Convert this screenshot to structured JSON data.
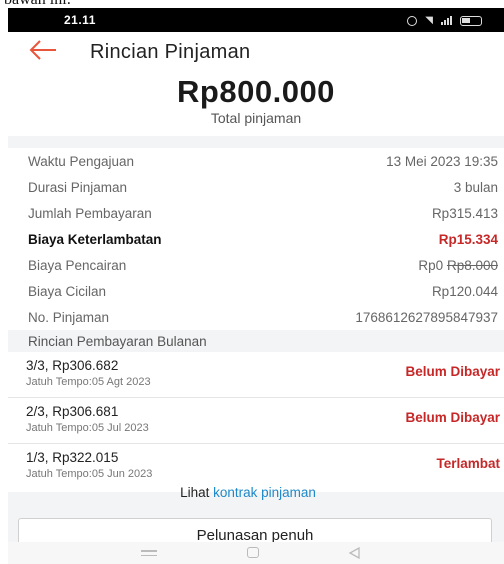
{
  "cut_text": "bawah ini:",
  "status": {
    "time": "21.11"
  },
  "header": {
    "title": "Rincian Pinjaman"
  },
  "summary": {
    "amount": "Rp800.000",
    "label": "Total pinjaman"
  },
  "details": [
    {
      "label": "Waktu Pengajuan",
      "value": "13 Mei 2023 19:35"
    },
    {
      "label": "Durasi Pinjaman",
      "value": "3 bulan"
    },
    {
      "label": "Jumlah Pembayaran",
      "value": "Rp315.413"
    },
    {
      "label": "Biaya Keterlambatan",
      "value": "Rp15.334"
    },
    {
      "label": "Biaya Pencairan",
      "value": "Rp0",
      "struck_value": "Rp8.000"
    },
    {
      "label": "Biaya Cicilan",
      "value": "Rp120.044"
    },
    {
      "label": "No. Pinjaman",
      "value": "1768612627895847937"
    }
  ],
  "payments": {
    "title": "Rincian Pembayaran Bulanan",
    "items": [
      {
        "amount": "3/3, Rp306.682",
        "due": "Jatuh Tempo:05 Agt 2023",
        "status": "Belum Dibayar"
      },
      {
        "amount": "2/3, Rp306.681",
        "due": "Jatuh Tempo:05 Jul 2023",
        "status": "Belum Dibayar"
      },
      {
        "amount": "1/3, Rp322.015",
        "due": "Jatuh Tempo:05 Jun 2023",
        "status": "Terlambat"
      }
    ]
  },
  "contract": {
    "prefix": "Lihat",
    "link": "kontrak pinjaman"
  },
  "actions": {
    "full_payment": "Pelunasan penuh"
  },
  "colors": {
    "accent": "#e8553a",
    "late": "#c62828",
    "link": "#1e88c8"
  }
}
